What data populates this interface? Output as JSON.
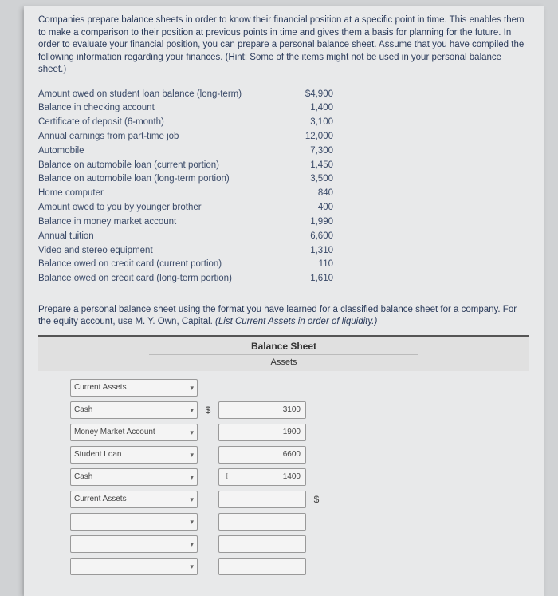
{
  "intro": "Companies prepare balance sheets in order to know their financial position at a specific point in time. This enables them to make a comparison to their position at previous points in time and gives them a basis for planning for the future. In order to evaluate your financial position, you can prepare a personal balance sheet. Assume that you have compiled the following information regarding your finances. (Hint: Some of the items might not be used in your personal balance sheet.)",
  "items": [
    {
      "label": "Amount owed on student loan balance (long-term)",
      "value": "$4,900"
    },
    {
      "label": "Balance in checking account",
      "value": "1,400"
    },
    {
      "label": "Certificate of deposit (6-month)",
      "value": "3,100"
    },
    {
      "label": "Annual earnings from part-time job",
      "value": "12,000"
    },
    {
      "label": "Automobile",
      "value": "7,300"
    },
    {
      "label": "Balance on automobile loan (current portion)",
      "value": "1,450"
    },
    {
      "label": "Balance on automobile loan (long-term portion)",
      "value": "3,500"
    },
    {
      "label": "Home computer",
      "value": "840"
    },
    {
      "label": "Amount owed to you by younger brother",
      "value": "400"
    },
    {
      "label": "Balance in money market account",
      "value": "1,990"
    },
    {
      "label": "Annual tuition",
      "value": "6,600"
    },
    {
      "label": "Video and stereo equipment",
      "value": "1,310"
    },
    {
      "label": "Balance owed on credit card (current portion)",
      "value": "110"
    },
    {
      "label": "Balance owed on credit card (long-term portion)",
      "value": "1,610"
    }
  ],
  "instruction_a": "Prepare a personal balance sheet using the format you have learned for a classified balance sheet for a company. For the equity account, use M. Y. Own, Capital. ",
  "instruction_b": "(List Current Assets in order of liquidity.)",
  "sheet": {
    "title": "Balance Sheet",
    "section": "Assets"
  },
  "rows": [
    {
      "select": "Current Assets",
      "dollar": "",
      "value": "",
      "trailing_dollar": ""
    },
    {
      "select": "Cash",
      "dollar": "$",
      "value": "3100",
      "trailing_dollar": ""
    },
    {
      "select": "Money Market Account",
      "dollar": "",
      "value": "1900",
      "trailing_dollar": ""
    },
    {
      "select": "Student Loan",
      "dollar": "",
      "value": "6600",
      "trailing_dollar": ""
    },
    {
      "select": "Cash",
      "dollar": "",
      "value": "1400",
      "cursor": true,
      "trailing_dollar": ""
    },
    {
      "select": "Current Assets",
      "dollar": "",
      "value": "",
      "trailing_dollar": "$"
    },
    {
      "select": "",
      "dollar": "",
      "value": "",
      "trailing_dollar": ""
    },
    {
      "select": "",
      "dollar": "",
      "value": "",
      "trailing_dollar": ""
    },
    {
      "select": "",
      "dollar": "",
      "value": "",
      "trailing_dollar": ""
    }
  ]
}
